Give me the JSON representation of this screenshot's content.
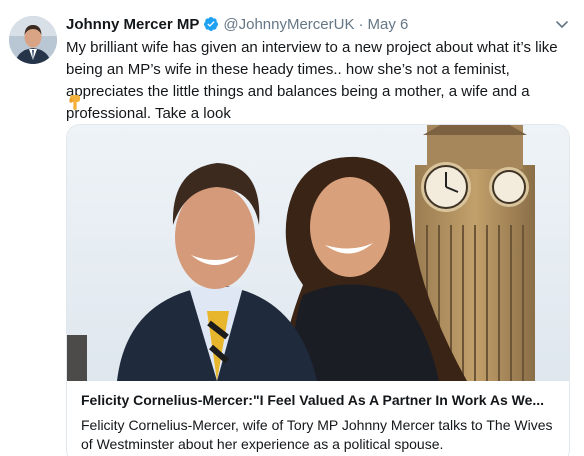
{
  "tweet": {
    "display_name": "Johnny Mercer MP",
    "handle": "@JohnnyMercerUK",
    "separator": "·",
    "date": "May 6",
    "text": "My brilliant wife has given an interview to a new project about what it’s like being an MP’s wife in these heady times.. how she’s not a feminist, appreciates the little things and balances being a mother, a wife and a professional. Take a look",
    "emoji_icon": "pointing-down-hand",
    "verified_icon": "verified-badge",
    "menu_icon": "chevron-down",
    "verified_color": "#1da1f2"
  },
  "card": {
    "title": "Felicity Cornelius-Mercer:\"I Feel Valued As A Partner In Work As We...",
    "description": "Felicity Cornelius-Mercer, wife of Tory MP Johnny Mercer talks to The Wives of Westminster about her experience as a political spouse."
  }
}
